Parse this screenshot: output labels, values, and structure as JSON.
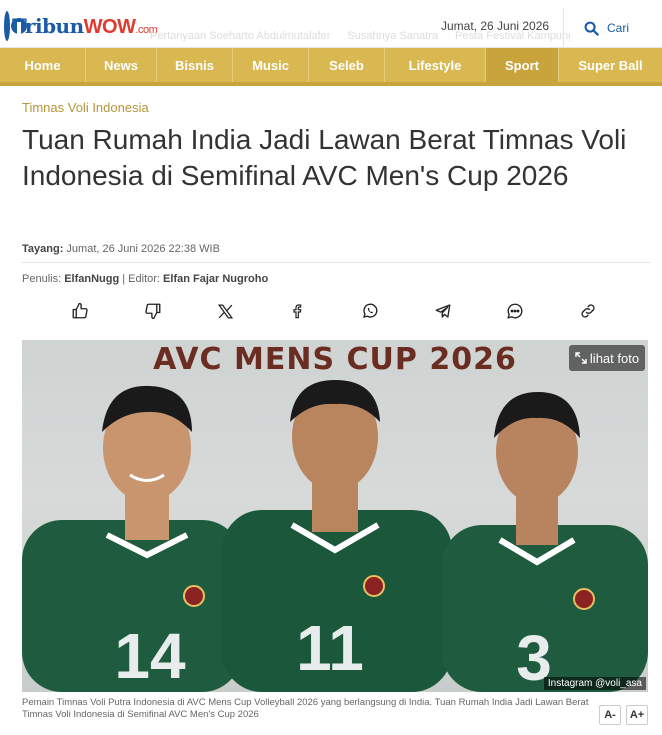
{
  "header": {
    "logo": {
      "part1": "Tribun",
      "part2": "WOW",
      "part3": ".com"
    },
    "ticker": [
      "Pertanyaan Soeharto Abdulmutalafer",
      "Susahnya Sanatra",
      "Pesta Festival Kampung"
    ],
    "date": "Jumat, 26 Juni 2026",
    "search_label": "Cari"
  },
  "nav": {
    "items": [
      {
        "label": "Home",
        "active": false
      },
      {
        "label": "News",
        "active": false
      },
      {
        "label": "Bisnis",
        "active": false
      },
      {
        "label": "Music",
        "active": false
      },
      {
        "label": "Seleb",
        "active": false
      },
      {
        "label": "Lifestyle",
        "active": false
      },
      {
        "label": "Sport",
        "active": true
      },
      {
        "label": "Super Ball",
        "active": false
      }
    ]
  },
  "article": {
    "category": "Timnas Voli Indonesia",
    "title": "Tuan Rumah India Jadi Lawan Berat Timnas Voli Indonesia di Semifinal AVC Men's Cup 2026",
    "tayang_label": "Tayang:",
    "tayang_value": "Jumat, 26 Juni 2026 22:38 WIB",
    "penulis_label": "Penulis:",
    "penulis_name": "ElfanNugg",
    "editor_label": "| Editor:",
    "editor_name": "Elfan Fajar Nugroho",
    "share_icons": [
      "thumbs-up-icon",
      "thumbs-down-icon",
      "x-icon",
      "facebook-icon",
      "whatsapp-icon",
      "telegram-icon",
      "comment-icon",
      "link-icon"
    ]
  },
  "photo": {
    "banner": "AVC MENS CUP 2026",
    "lihat_foto": "lihat foto",
    "credit": "Instagram @voli_asa",
    "jersey_numbers": [
      "14",
      "11",
      "3"
    ],
    "caption": "Pemain Timnas Voli Putra Indonesia di AVC Mens Cup Volleyball 2026 yang berlangsung di India. Tuan Rumah India Jadi Lawan Berat Timnas Voli Indonesia di Semifinal AVC Men's Cup 2026",
    "font_decrease": "A-",
    "font_increase": "A+"
  },
  "colors": {
    "nav_gold": "#d9b751",
    "nav_active": "#c9a43c",
    "brand_blue": "#1b5aa6",
    "jersey_green": "#1f5c3f",
    "banner_text": "#6b2c22"
  }
}
